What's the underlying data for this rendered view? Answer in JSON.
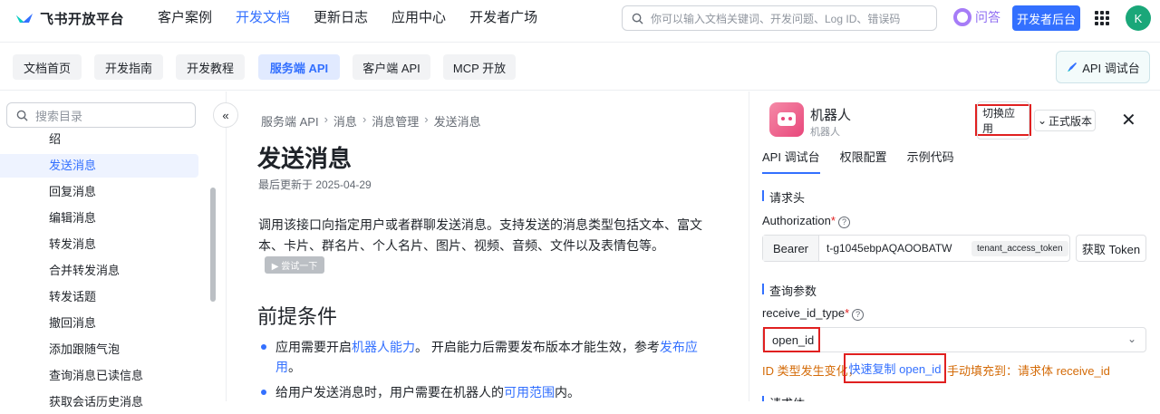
{
  "topbar": {
    "logo_text": "飞书开放平台",
    "nav": [
      "客户案例",
      "开发文档",
      "更新日志",
      "应用中心",
      "开发者广场"
    ],
    "active_nav": "开发文档",
    "search_placeholder": "你可以输入文档关键词、开发问题、Log ID、错误码",
    "qa_label": "问答",
    "dev_console_label": "开发者后台",
    "avatar_letter": "K",
    "accent": "#3370ff"
  },
  "subbar": {
    "tabs": [
      "文档首页",
      "开发指南",
      "开发教程",
      "服务端 API",
      "客户端 API",
      "MCP 开放"
    ],
    "active_tab": "服务端 API",
    "api_console_label": "API 调试台"
  },
  "sidebar": {
    "search_placeholder": "搜索目录",
    "items": [
      "绍",
      "发送消息",
      "回复消息",
      "编辑消息",
      "转发消息",
      "合并转发消息",
      "转发话题",
      "撤回消息",
      "添加跟随气泡",
      "查询消息已读信息",
      "获取会话历史消息"
    ],
    "active_item": "发送消息"
  },
  "content": {
    "breadcrumb": [
      "服务端 API",
      "消息",
      "消息管理",
      "发送消息"
    ],
    "title": "发送消息",
    "updated": "最后更新于 2025-04-29",
    "intro": "调用该接口向指定用户或者群聊发送消息。支持发送的消息类型包括文本、富文本、卡片、群名片、个人名片、图片、视频、音频、文件以及表情包等。",
    "try_label": "▶ 尝试一下",
    "prereq_title": "前提条件",
    "bullet1": {
      "a": "应用需要开启",
      "link1": "机器人能力",
      "b": "。 开启能力后需要发布版本才能生效，参考",
      "link2": "发布应用",
      "c": "。"
    },
    "bullet2": {
      "a": "给用户发送消息时，用户需要在机器人的",
      "link": "可用范围",
      "b": "内。"
    }
  },
  "panel": {
    "bot_name": "机器人",
    "bot_sub": "机器人",
    "switch_label": "切换应用",
    "version_label": "正式版本",
    "tabs": [
      "API 调试台",
      "权限配置",
      "示例代码"
    ],
    "active_tab": "API 调试台",
    "header_section": "请求头",
    "auth_label": "Authorization",
    "bearer": "Bearer",
    "token_value": "t-g1045ebpAQAOOBATW",
    "token_tag": "tenant_access_token",
    "get_token_label": "获取 Token",
    "query_section": "查询参数",
    "receive_label": "receive_id_type",
    "receive_value": "open_id",
    "warn_prefix": "ID 类型发生变化，",
    "copy_link": "快速复制 open_id",
    "warn_suffix": "手动填充到：请求体 receive_id",
    "next_section": "请求体"
  }
}
